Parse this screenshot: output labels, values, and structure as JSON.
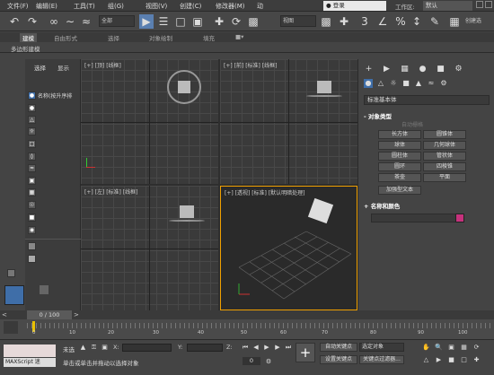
{
  "menu": {
    "items": [
      "文件(F)",
      "编辑(E)",
      "工具(T)",
      "组(G)",
      "视图(V)",
      "创建(C)",
      "修改器(M)",
      "动"
    ],
    "login": "登录",
    "workspace_label": "工作区:",
    "workspace_value": "默认"
  },
  "toolbar": {
    "filter_dropdown": "全部",
    "view_dropdown": "视图",
    "create_selection": "创建选",
    "icons": [
      "undo-icon",
      "redo-icon",
      "link-icon",
      "unlink-icon",
      "bind-space-warp-icon",
      "select-object-icon",
      "select-by-name-icon",
      "rect-selection-icon",
      "window-crossing-icon",
      "select-move-icon",
      "select-rotate-icon",
      "select-scale-icon",
      "use-pivot-icon",
      "select-manipulate-icon",
      "snaps-toggle-icon",
      "angle-snap-icon",
      "percent-snap-icon",
      "spinner-snap-icon"
    ]
  },
  "ribbon": {
    "tabs": [
      "建模",
      "自由形式",
      "选择",
      "对象绘制",
      "填充"
    ],
    "selected_tab": "建模",
    "sub_label": "多边形建模"
  },
  "scene_explorer": {
    "tabs": [
      "选择",
      "显示"
    ],
    "column_header": "名称(按升序排"
  },
  "viewports": [
    {
      "label": "[+] [顶] [线框]"
    },
    {
      "label": "[+] [前] [标准] [线框]"
    },
    {
      "label": "[+] [左] [标准] [线框]"
    },
    {
      "label": "[+] [透视] [标准] [默认明暗处理]"
    }
  ],
  "command_panel": {
    "dropdown": "标准基本体",
    "object_type_title": "对象类型",
    "autogrid": "自动栅格",
    "buttons": [
      "长方体",
      "圆锥体",
      "球体",
      "几何球体",
      "圆柱体",
      "管状体",
      "圆环",
      "四棱锥",
      "茶壶",
      "平面",
      "加强型文本"
    ],
    "name_color_title": "名称和颜色",
    "swatch_color": "#c6327c"
  },
  "timeline": {
    "frame_display": "0 / 100",
    "ticks": [
      "0",
      "10",
      "20",
      "30",
      "40",
      "50",
      "60",
      "70",
      "80",
      "90",
      "100"
    ]
  },
  "status": {
    "maxscript_label": "MAXScript 迷",
    "selection_text": "未选",
    "prompt_text": "单击或单击并拖动以选择对象",
    "x_label": "X:",
    "y_label": "Y:",
    "z_label": "Z:",
    "auto_key": "自动关键点",
    "selected_obj": "选定对象",
    "set_key": "设置关键点",
    "key_filters": "关键点过滤器...",
    "frame_value": "0"
  }
}
